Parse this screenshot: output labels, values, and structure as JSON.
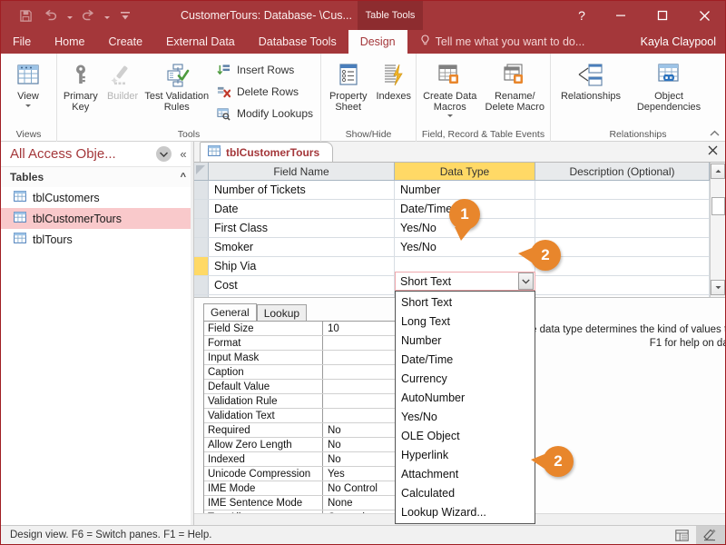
{
  "titlebar": {
    "quick_access": [
      {
        "name": "save-icon",
        "label": "Save"
      },
      {
        "name": "undo-icon",
        "label": "Undo"
      },
      {
        "name": "redo-icon",
        "label": "Redo"
      },
      {
        "name": "customize-qat-icon",
        "label": "Customize Quick Access Toolbar"
      }
    ],
    "document_title": "CustomerTours: Database- \\Cus...",
    "contextual_tab_group": "Table Tools",
    "window_buttons": {
      "help": "?",
      "minimize": "—",
      "restore": "☐",
      "close": "✕"
    }
  },
  "ribbon_tabs": {
    "items": [
      "File",
      "Home",
      "Create",
      "External Data",
      "Database Tools",
      "Design"
    ],
    "active": "Design",
    "tellme_placeholder": "Tell me what you want to do...",
    "user_name": "Kayla Claypool"
  },
  "ribbon": {
    "groups": [
      {
        "label": "Views",
        "buttons": [
          {
            "name": "view-button",
            "label": "View",
            "enabled": true,
            "has_menu": true
          }
        ]
      },
      {
        "label": "Tools",
        "buttons": [
          {
            "name": "primary-key-button",
            "label": "Primary Key",
            "enabled": true
          },
          {
            "name": "builder-button",
            "label": "Builder",
            "enabled": false
          },
          {
            "name": "test-validation-rules-button",
            "label": "Test Validation Rules",
            "enabled": true
          }
        ],
        "small_buttons": [
          {
            "name": "insert-rows-button",
            "label": "Insert Rows"
          },
          {
            "name": "delete-rows-button",
            "label": "Delete Rows"
          },
          {
            "name": "modify-lookups-button",
            "label": "Modify Lookups"
          }
        ]
      },
      {
        "label": "Show/Hide",
        "buttons": [
          {
            "name": "property-sheet-button",
            "label": "Property Sheet",
            "enabled": true
          },
          {
            "name": "indexes-button",
            "label": "Indexes",
            "enabled": true
          }
        ]
      },
      {
        "label": "Field, Record & Table Events",
        "buttons": [
          {
            "name": "create-data-macros-button",
            "label": "Create Data Macros",
            "enabled": true,
            "has_menu": true
          },
          {
            "name": "rename-delete-macro-button",
            "label": "Rename/ Delete Macro",
            "enabled": true
          }
        ]
      },
      {
        "label": "Relationships",
        "buttons": [
          {
            "name": "relationships-button",
            "label": "Relationships",
            "enabled": true
          },
          {
            "name": "object-dependencies-button",
            "label": "Object Dependencies",
            "enabled": true
          }
        ]
      }
    ]
  },
  "navpane": {
    "title": "All Access Obje...",
    "group_label": "Tables",
    "items": [
      {
        "label": "tblCustomers",
        "selected": false
      },
      {
        "label": "tblCustomerTours",
        "selected": true
      },
      {
        "label": "tblTours",
        "selected": false
      }
    ]
  },
  "document": {
    "tab_label": "tblCustomerTours",
    "grid": {
      "columns": [
        "Field Name",
        "Data Type",
        "Description (Optional)"
      ],
      "rows": [
        {
          "field_name": "Number of Tickets",
          "data_type": "Number",
          "description": "",
          "active": false
        },
        {
          "field_name": "Date",
          "data_type": "Date/Time",
          "description": "",
          "active": false
        },
        {
          "field_name": "First Class",
          "data_type": "Yes/No",
          "description": "",
          "active": false
        },
        {
          "field_name": "Smoker",
          "data_type": "Yes/No",
          "description": "",
          "active": false
        },
        {
          "field_name": "Ship Via",
          "data_type": "Short Text",
          "description": "",
          "active": true
        },
        {
          "field_name": "Cost",
          "data_type": "",
          "description": "",
          "active": false
        }
      ],
      "active_value": "Short Text",
      "dropdown_open": true,
      "dropdown_options": [
        "Short Text",
        "Long Text",
        "Number",
        "Date/Time",
        "Currency",
        "AutoNumber",
        "Yes/No",
        "OLE Object",
        "Hyperlink",
        "Attachment",
        "Calculated",
        "Lookup Wizard..."
      ]
    }
  },
  "field_properties": {
    "tabs": [
      "General",
      "Lookup"
    ],
    "active_tab": "General",
    "rows": [
      {
        "name": "Field Size",
        "value": "10"
      },
      {
        "name": "Format",
        "value": ""
      },
      {
        "name": "Input Mask",
        "value": ""
      },
      {
        "name": "Caption",
        "value": ""
      },
      {
        "name": "Default Value",
        "value": ""
      },
      {
        "name": "Validation Rule",
        "value": ""
      },
      {
        "name": "Validation Text",
        "value": ""
      },
      {
        "name": "Required",
        "value": "No"
      },
      {
        "name": "Allow Zero Length",
        "value": "No"
      },
      {
        "name": "Indexed",
        "value": "No"
      },
      {
        "name": "Unicode Compression",
        "value": "Yes"
      },
      {
        "name": "IME Mode",
        "value": "No Control"
      },
      {
        "name": "IME Sentence Mode",
        "value": "None"
      },
      {
        "name": "Text Align",
        "value": "General"
      }
    ],
    "help_text": "The data type determines the kind of values that users can store in the field. Press F1 for help on data types."
  },
  "statusbar": {
    "text": "Design view.  F6 = Switch panes.  F1 = Help.",
    "view_buttons": [
      {
        "name": "datasheet-view-button",
        "active": false
      },
      {
        "name": "design-view-button",
        "active": true
      }
    ]
  },
  "callouts": [
    {
      "number": "1",
      "style": "down"
    },
    {
      "number": "2",
      "style": "left"
    },
    {
      "number": "2",
      "style": "left"
    }
  ],
  "colors": {
    "accent": "#a4373a",
    "contextual_tab": "#8d2c2f",
    "datatype_header": "#ffd966",
    "selected_nav_item": "#f9c9cb",
    "callout": "#e8862c"
  }
}
